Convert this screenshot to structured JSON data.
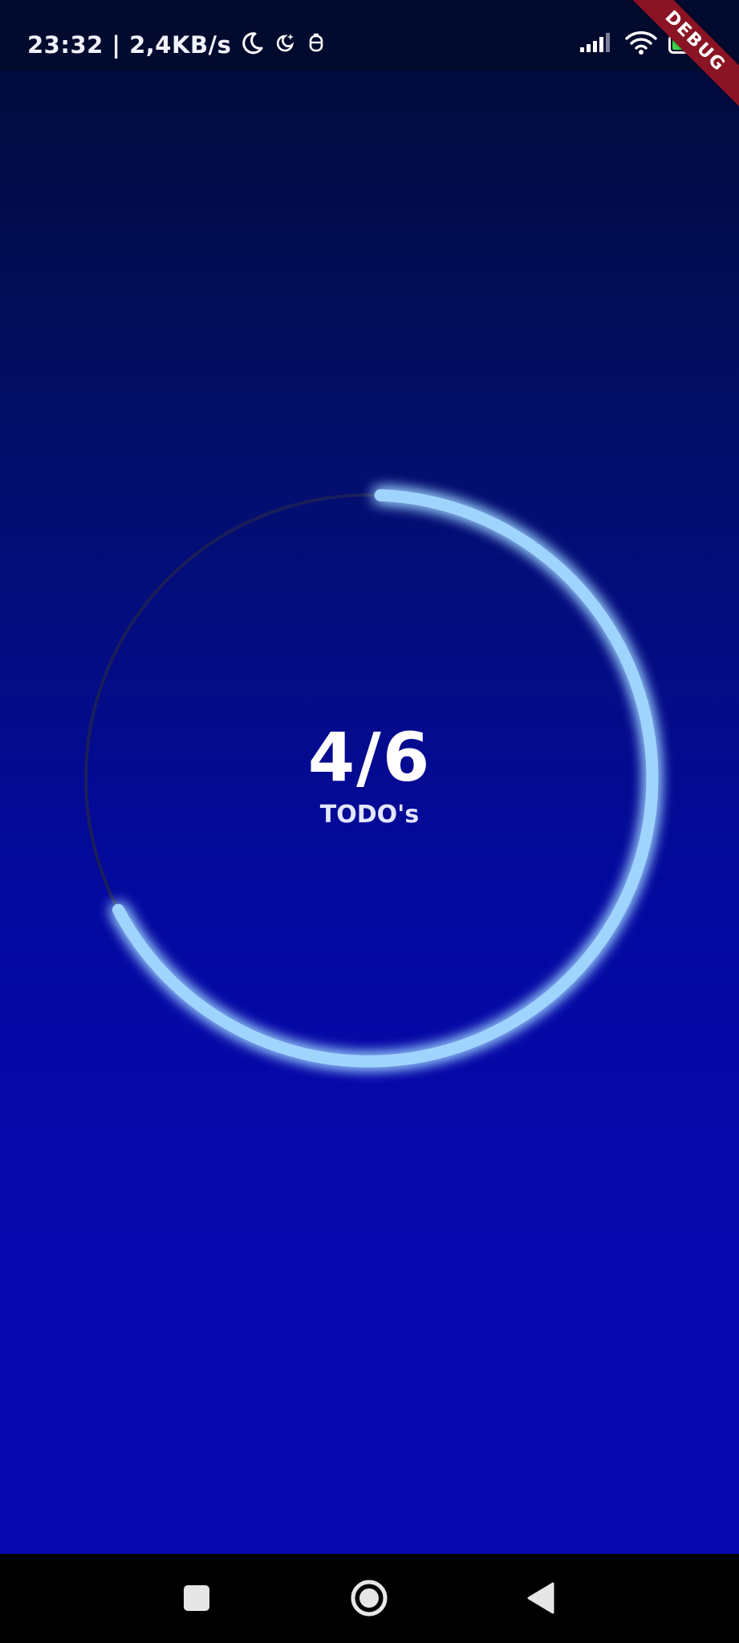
{
  "status_bar": {
    "time_speed": "23:32 | 2,4KB/s",
    "icons": [
      "moon-icon",
      "night-mode-icon",
      "notification-icon"
    ],
    "right_icons": [
      "signal-icon",
      "wifi-icon",
      "battery-icon"
    ],
    "battery_level": "47",
    "battery_fraction": 0.47
  },
  "debug_banner": "DEBUG",
  "progress": {
    "completed": 4,
    "total": 6,
    "fraction": 0.6667,
    "counter_text": "4/6",
    "label": "TODO's",
    "colors": {
      "arc": "#9fd4ff",
      "arc_glow": "#6fb6ff",
      "track": "#1a1f5a"
    }
  },
  "nav_bar": {
    "buttons": [
      "recent-apps-button",
      "home-button",
      "back-button"
    ]
  },
  "colors": {
    "background_top": "#020a34",
    "background_bottom": "#0708ad",
    "nav_bar": "#000000",
    "debug_ribbon": "#8a1424"
  }
}
